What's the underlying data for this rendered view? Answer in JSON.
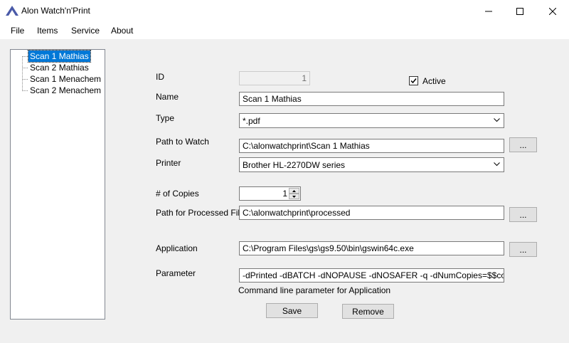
{
  "window": {
    "title": "Alon Watch'n'Print"
  },
  "menu": {
    "items": [
      "File",
      "Items",
      "Service",
      "About"
    ]
  },
  "tree": {
    "items": [
      {
        "label": "Scan 1 Mathias",
        "selected": true
      },
      {
        "label": "Scan 2 Mathias",
        "selected": false
      },
      {
        "label": "Scan 1 Menachem",
        "selected": false
      },
      {
        "label": "Scan 2 Menachem",
        "selected": false
      }
    ]
  },
  "form": {
    "id_label": "ID",
    "id_value": "1",
    "active_label": "Active",
    "active_checked": true,
    "name_label": "Name",
    "name_value": "Scan 1 Mathias",
    "type_label": "Type",
    "type_value": "*.pdf",
    "path_watch_label": "Path to Watch",
    "path_watch_value": "C:\\alonwatchprint\\Scan 1 Mathias",
    "printer_label": "Printer",
    "printer_value": "Brother HL-2270DW series",
    "copies_label": "# of Copies",
    "copies_value": "1",
    "path_processed_label": "Path for Processed File",
    "path_processed_value": "C:\\alonwatchprint\\processed",
    "application_label": "Application",
    "application_value": "C:\\Program Files\\gs\\gs9.50\\bin\\gswin64c.exe",
    "parameter_label": "Parameter",
    "parameter_value": "-dPrinted -dBATCH -dNOPAUSE -dNOSAFER -q -dNumCopies=$$copies -sD",
    "parameter_hint": "Command line parameter for Application",
    "browse_label": "...",
    "save_label": "Save",
    "remove_label": "Remove"
  },
  "colors": {
    "selection": "#0078d7",
    "window_bg": "#f0f0f0",
    "accent_icon": "#4a5aa8"
  },
  "icons": {
    "app": "app-logo-icon",
    "minimize": "minimize-icon",
    "maximize": "maximize-icon",
    "close": "close-icon",
    "dropdown": "chevron-down-icon",
    "check": "checkmark-icon"
  }
}
